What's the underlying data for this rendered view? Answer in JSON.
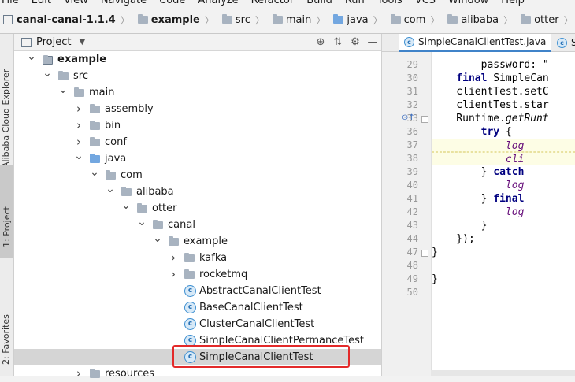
{
  "menu": [
    "File",
    "Edit",
    "View",
    "Navigate",
    "Code",
    "Analyze",
    "Refactor",
    "Build",
    "Run",
    "Tools",
    "VCS",
    "Window",
    "Help"
  ],
  "breadcrumb": [
    "canal-canal-1.1.4",
    "example",
    "src",
    "main",
    "java",
    "com",
    "alibaba",
    "otter",
    "canal",
    "example",
    "SimpleCanalClientTest"
  ],
  "left_tool_tabs": {
    "cloud": "Alibaba Cloud Explorer",
    "project": "1: Project",
    "favorites": "2: Favorites"
  },
  "project_panel": {
    "title": "Project",
    "tree": [
      {
        "label": "example",
        "indent": 1,
        "arrow": "open",
        "icon": "module",
        "bold": true
      },
      {
        "label": "src",
        "indent": 2,
        "arrow": "open",
        "icon": "folder"
      },
      {
        "label": "main",
        "indent": 3,
        "arrow": "open",
        "icon": "folder"
      },
      {
        "label": "assembly",
        "indent": 4,
        "arrow": "closed",
        "icon": "folder"
      },
      {
        "label": "bin",
        "indent": 4,
        "arrow": "closed",
        "icon": "folder"
      },
      {
        "label": "conf",
        "indent": 4,
        "arrow": "closed",
        "icon": "folder"
      },
      {
        "label": "java",
        "indent": 4,
        "arrow": "open",
        "icon": "source-folder"
      },
      {
        "label": "com",
        "indent": 5,
        "arrow": "open",
        "icon": "folder"
      },
      {
        "label": "alibaba",
        "indent": 6,
        "arrow": "open",
        "icon": "folder"
      },
      {
        "label": "otter",
        "indent": 7,
        "arrow": "open",
        "icon": "folder"
      },
      {
        "label": "canal",
        "indent": 8,
        "arrow": "open",
        "icon": "folder"
      },
      {
        "label": "example",
        "indent": 9,
        "arrow": "open",
        "icon": "folder"
      },
      {
        "label": "kafka",
        "indent": 10,
        "arrow": "closed",
        "icon": "folder"
      },
      {
        "label": "rocketmq",
        "indent": 10,
        "arrow": "closed",
        "icon": "folder"
      },
      {
        "label": "AbstractCanalClientTest",
        "indent": 10,
        "arrow": "none",
        "icon": "class"
      },
      {
        "label": "BaseCanalClientTest",
        "indent": 10,
        "arrow": "none",
        "icon": "class"
      },
      {
        "label": "ClusterCanalClientTest",
        "indent": 10,
        "arrow": "none",
        "icon": "class"
      },
      {
        "label": "SimpleCanalClientPermanceTest",
        "indent": 10,
        "arrow": "none",
        "icon": "class"
      },
      {
        "label": "SimpleCanalClientTest",
        "indent": 10,
        "arrow": "none",
        "icon": "class",
        "selected": true
      },
      {
        "label": "resources",
        "indent": 4,
        "arrow": "closed",
        "icon": "folder"
      }
    ]
  },
  "editor": {
    "tabs": [
      "SimpleCanalClientTest.java",
      "S"
    ],
    "lines": [
      {
        "n": "29",
        "code": "        password: \""
      },
      {
        "n": "30",
        "code": "    final SimpleCan"
      },
      {
        "n": "31",
        "code": "    clientTest.setC"
      },
      {
        "n": "32",
        "code": "    clientTest.star"
      },
      {
        "n": "33",
        "code": "    Runtime.getRunt"
      },
      {
        "n": "36",
        "code": "        try {"
      },
      {
        "n": "37",
        "code": "            log"
      },
      {
        "n": "38",
        "code": "            cli"
      },
      {
        "n": "39",
        "code": "        } catch"
      },
      {
        "n": "40",
        "code": "            log"
      },
      {
        "n": "41",
        "code": "        } final"
      },
      {
        "n": "42",
        "code": "            log"
      },
      {
        "n": "43",
        "code": "        }"
      },
      {
        "n": "44",
        "code": "    });"
      },
      {
        "n": "47",
        "code": "}"
      },
      {
        "n": "48",
        "code": ""
      },
      {
        "n": "49",
        "code": "}"
      },
      {
        "n": "50",
        "code": ""
      }
    ]
  }
}
